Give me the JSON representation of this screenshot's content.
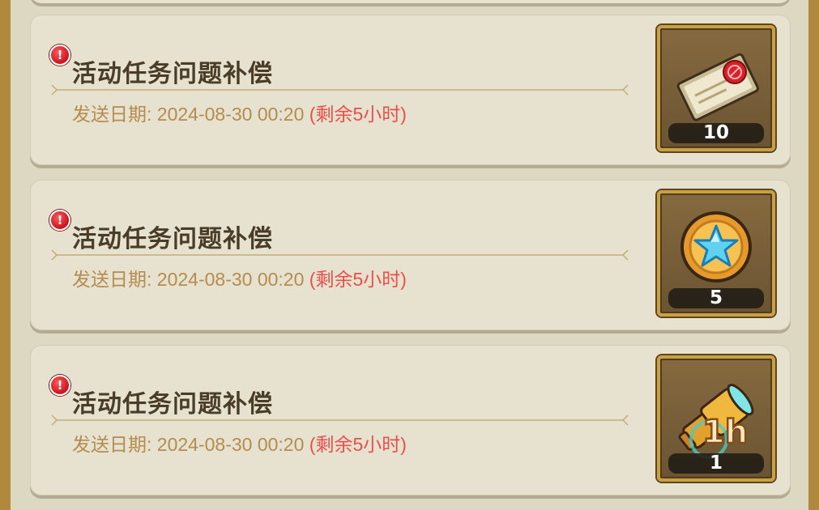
{
  "mails": [
    {
      "badge": "!",
      "title": "活动任务问题补偿",
      "date_label": "发送日期:",
      "date_value": "2024-08-30 00:20",
      "remaining": "(剩余5小时)",
      "reward": {
        "icon": "ticket-icon",
        "count": "10"
      }
    },
    {
      "badge": "!",
      "title": "活动任务问题补偿",
      "date_label": "发送日期:",
      "date_value": "2024-08-30 00:20",
      "remaining": "(剩余5小时)",
      "reward": {
        "icon": "star-coin-icon",
        "count": "5"
      }
    },
    {
      "badge": "!",
      "title": "活动任务问题补偿",
      "date_label": "发送日期:",
      "date_value": "2024-08-30 00:20",
      "remaining": "(剩余5小时)",
      "reward": {
        "icon": "telescope-icon",
        "overlay": "1h",
        "count": "1"
      }
    }
  ],
  "colors": {
    "frame": "#b0893d",
    "card": "#e6e2cf",
    "title": "#4a3d28",
    "date": "#b58c4f",
    "remaining": "#e8504b",
    "badge": "#c8141e",
    "slot_border": "#c9a042"
  }
}
